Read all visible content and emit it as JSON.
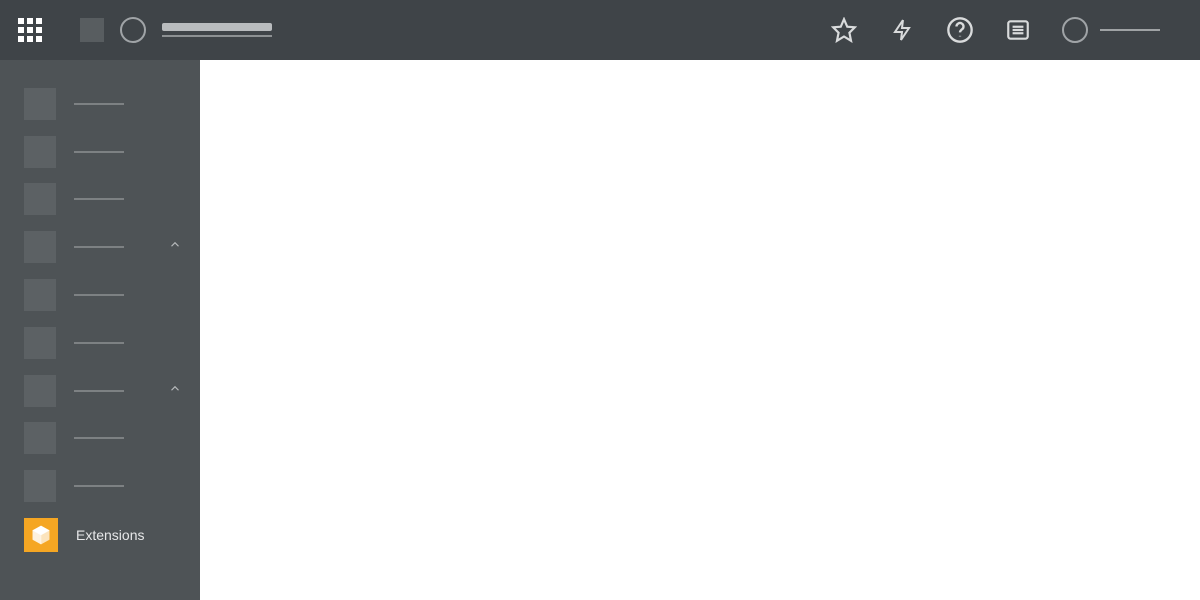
{
  "header": {
    "apps_icon": "apps-grid",
    "project_square": "project-icon",
    "avatar": "user-circle",
    "title_primary": "",
    "title_secondary": ""
  },
  "toolbar": {
    "star": "star-icon",
    "bolt": "bolt-icon",
    "help": "help-icon",
    "list": "list-icon",
    "user_circle": "user-avatar",
    "user_name": ""
  },
  "sidebar": {
    "items": [
      {
        "label": "",
        "expandable": false
      },
      {
        "label": "",
        "expandable": false
      },
      {
        "label": "",
        "expandable": false
      },
      {
        "label": "",
        "expandable": true
      },
      {
        "label": "",
        "expandable": false
      },
      {
        "label": "",
        "expandable": false
      },
      {
        "label": "",
        "expandable": true
      },
      {
        "label": "",
        "expandable": false
      },
      {
        "label": "",
        "expandable": false
      }
    ],
    "extensions_label": "Extensions"
  }
}
